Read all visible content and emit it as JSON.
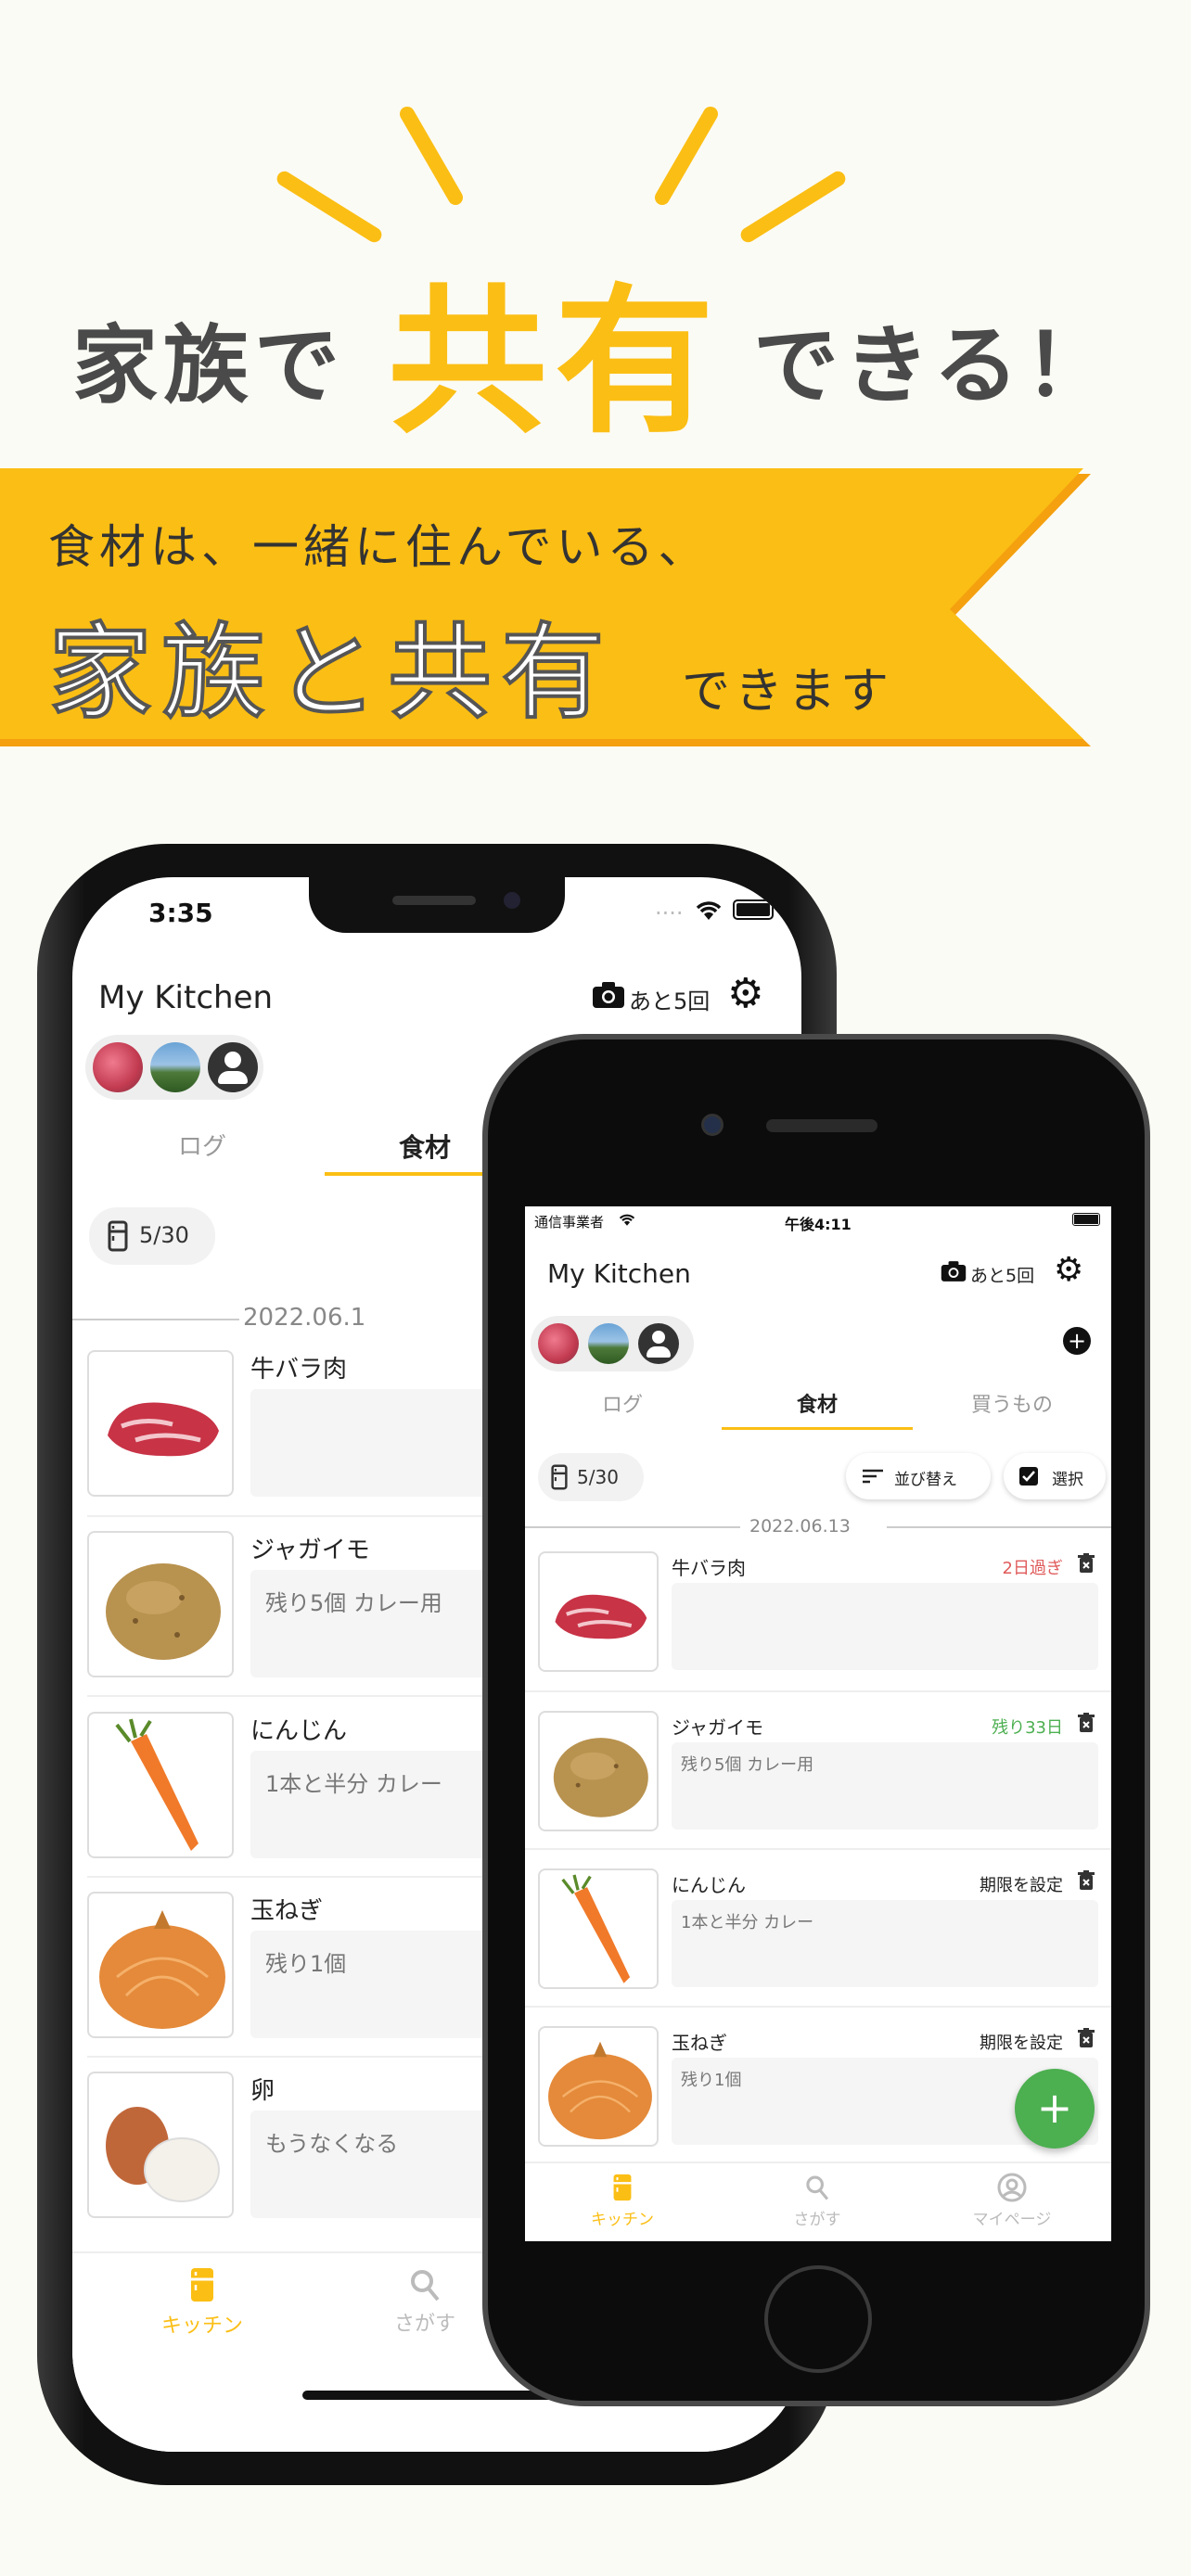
{
  "headline": {
    "pre": "家族で",
    "big": "共有",
    "post": "できる！"
  },
  "ribbon": {
    "line1": "食材は、一緒に住んでいる、",
    "big": "家族と共有",
    "small": "できます"
  },
  "colors": {
    "accent": "#fbbe14",
    "ribbon": "#fbbe14",
    "ribbon_edge": "#f4a00f",
    "expired": "#e05a5a",
    "remaining": "#4caf50",
    "fab": "#4caf50"
  },
  "big_phone": {
    "time": "3:35",
    "signal": "....",
    "app_title": "My Kitchen",
    "camera_remaining": "あと5回",
    "tabs": [
      "ログ",
      "食材"
    ],
    "fridge_count": "5/30",
    "date": "2022.06.1",
    "items": [
      {
        "name": "牛バラ肉",
        "memo": "",
        "icon": "beef-icon"
      },
      {
        "name": "ジャガイモ",
        "memo": "残り5個 カレー用",
        "icon": "potato-icon"
      },
      {
        "name": "にんじん",
        "memo": "1本と半分 カレー",
        "icon": "carrot-icon"
      },
      {
        "name": "玉ねぎ",
        "memo": "残り1個",
        "icon": "onion-icon"
      },
      {
        "name": "卵",
        "memo": "もうなくなる",
        "icon": "egg-icon"
      }
    ],
    "nav": [
      "キッチン",
      "さがす"
    ]
  },
  "small_phone": {
    "carrier": "通信事業者",
    "time": "午後4:11",
    "app_title": "My Kitchen",
    "camera_remaining": "あと5回",
    "tabs": [
      "ログ",
      "食材",
      "買うもの"
    ],
    "fridge_count": "5/30",
    "sort_label": "並び替え",
    "select_label": "選択",
    "date": "2022.06.13",
    "items": [
      {
        "name": "牛バラ肉",
        "status": "2日過ぎ",
        "status_color": "#e05a5a",
        "memo": "",
        "icon": "beef-icon"
      },
      {
        "name": "ジャガイモ",
        "status": "残り33日",
        "status_color": "#4caf50",
        "memo": "残り5個 カレー用",
        "icon": "potato-icon"
      },
      {
        "name": "にんじん",
        "status": "期限を設定",
        "status_color": "#222222",
        "memo": "1本と半分 カレー",
        "icon": "carrot-icon"
      },
      {
        "name": "玉ねぎ",
        "status": "期限を設定",
        "status_color": "#222222",
        "memo": "残り1個",
        "icon": "onion-icon"
      }
    ],
    "fab_label": "+",
    "nav": [
      "キッチン",
      "さがす",
      "マイページ"
    ]
  }
}
